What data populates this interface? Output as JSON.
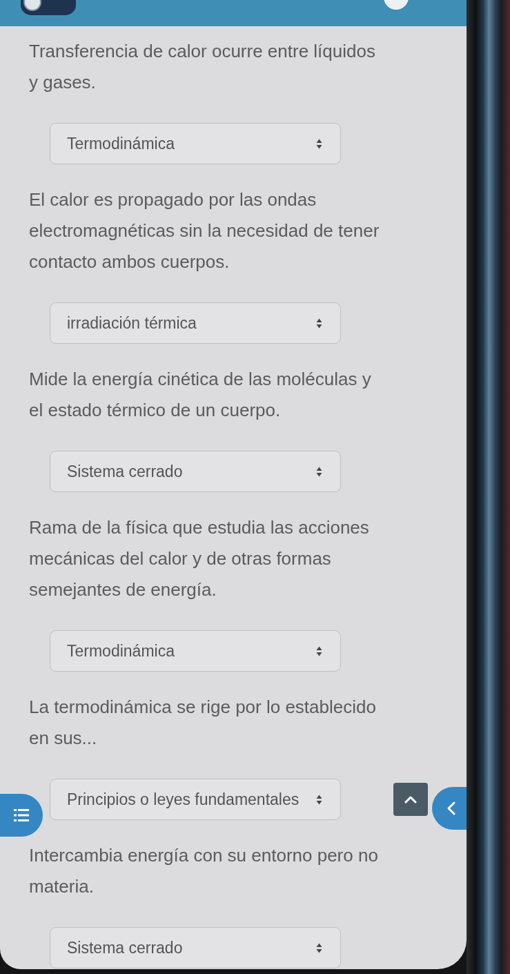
{
  "questions": [
    {
      "prompt_lines": [
        "Transferencia de calor ocurre entre líquidos",
        "y gases."
      ],
      "answer": "Termodinámica"
    },
    {
      "prompt_lines": [
        "El calor es propagado por las ondas",
        "electromagnéticas sin la necesidad de tener",
        "contacto ambos cuerpos."
      ],
      "answer": "irradiación térmica"
    },
    {
      "prompt_lines": [
        "Mide la energía cinética de las moléculas y",
        "el estado térmico de un cuerpo."
      ],
      "answer": "Sistema cerrado"
    },
    {
      "prompt_lines": [
        "Rama de la física que estudia las acciones",
        "mecánicas del calor y de otras formas",
        "semejantes de energía."
      ],
      "answer": "Termodinámica"
    },
    {
      "prompt_lines": [
        "La termodinámica se rige por lo establecido",
        "en sus..."
      ],
      "answer": "Principios o leyes fundamentales"
    },
    {
      "prompt_lines": [
        "Intercambia energía con su entorno pero no",
        "materia."
      ],
      "answer": "Sistema cerrado"
    }
  ]
}
